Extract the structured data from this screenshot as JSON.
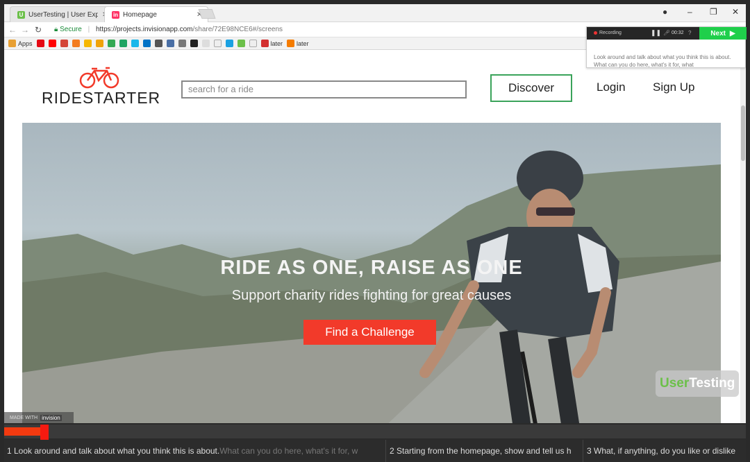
{
  "browser": {
    "tabs": [
      {
        "label": "UserTesting | User Experi...",
        "favicon": "U",
        "favicon_color": "#6cc04a"
      },
      {
        "label": "Homepage",
        "favicon": "in",
        "favicon_color": "#ff3366"
      }
    ],
    "url_secure": "Secure",
    "url_main": "https://projects.invisionapp.com",
    "url_rest": "/share/72E98NCE6#/screens",
    "bookmarks": {
      "apps_label": "Apps",
      "later1": "later",
      "later2": "later"
    }
  },
  "page": {
    "logo_text": "RIDESTARTER",
    "search_placeholder": "search for a ride",
    "nav": {
      "discover": "Discover",
      "login": "Login",
      "signup": "Sign Up"
    },
    "hero": {
      "title": "RIDE AS ONE, RAISE AS ONE",
      "subtitle": "Support charity rides fighting for great causes",
      "cta": "Find a Challenge"
    },
    "made_with": "MADE WITH",
    "made_with_brand": "invision"
  },
  "recorder": {
    "status": "Recording",
    "time": "00:32",
    "next_label": "Next",
    "task_text": "Look around and talk about what you think this is about. What can you do here, what's it for, what"
  },
  "watermark": {
    "user": "User",
    "testing": "Testing"
  },
  "progress": {
    "fraction": 0.05
  },
  "tasks": [
    {
      "lead": "1 Look around and talk about what you think this is about.",
      "rest": " What can you do here, what's it for, w"
    },
    {
      "lead": "2 Starting from the homepage, show and tell us h",
      "rest": ""
    },
    {
      "lead": "3 What, if anything, do you like or dislike",
      "rest": ""
    }
  ]
}
